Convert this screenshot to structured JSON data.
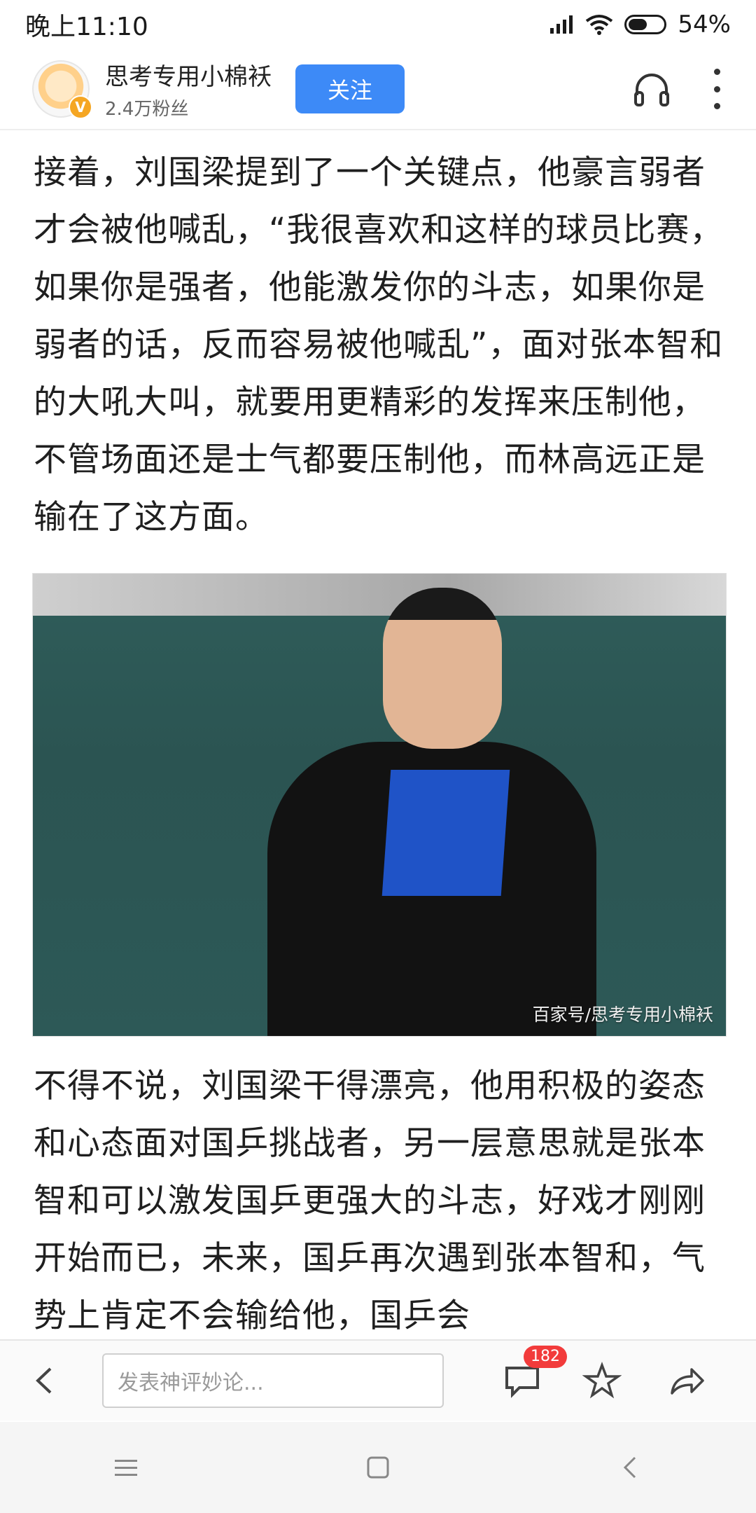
{
  "status_bar": {
    "time": "晚上11:10",
    "battery_percent": "54%",
    "battery_level": 0.54
  },
  "header": {
    "author_name": "思考专用小棉袄",
    "fans": "2.4万粉丝",
    "follow_label": "关注",
    "verified_badge": "V",
    "icons": [
      "headphone-icon",
      "more-vertical-icon"
    ]
  },
  "article": {
    "paragraph_1": "接着，刘国梁提到了一个关键点，他豪言弱者才会被他喊乱，“我很喜欢和这样的球员比赛，如果你是强者，他能激发你的斗志，如果你是弱者的话，反而容易被他喊乱”，面对张本智和的大吼大叫，就要用更精彩的发挥来压制他，不管场面还是士气都要压制他，而林高远正是输在了这方面。",
    "image_caption": "百家号/思考专用小棉袄",
    "paragraph_2": "不得不说，刘国梁干得漂亮，他用积极的姿态和心态面对国乒挑战者，另一层意思就是张本智和可以激发国乒更强大的斗志，好戏才刚刚开始而已，未来，国乒再次遇到张本智和，气势上肯定不会输给他，国乒会"
  },
  "bottom_bar": {
    "comment_placeholder": "发表神评妙论...",
    "comment_count": "182",
    "icons": [
      "back-arrow-icon",
      "comment-icon",
      "star-icon",
      "share-icon"
    ]
  },
  "nav_bar": {
    "icons": [
      "menu-icon",
      "home-icon",
      "back-icon"
    ]
  },
  "colors": {
    "accent": "#3d8af7",
    "badge": "#f23b3b"
  }
}
